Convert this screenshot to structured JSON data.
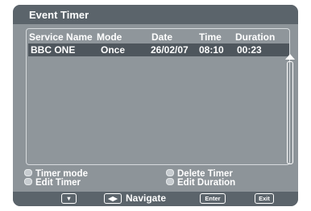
{
  "window": {
    "title": "Event Timer"
  },
  "table": {
    "headers": [
      "Service Name",
      "Mode",
      "Date",
      "Time",
      "Duration"
    ],
    "rows": [
      {
        "service": "BBC ONE",
        "mode": "Once",
        "date": "26/02/07",
        "time": "08:10",
        "duration": "00:23"
      }
    ]
  },
  "legend": {
    "timer_mode": "Timer mode",
    "edit_timer": "Edit Timer",
    "delete_timer": "Delete Timer",
    "edit_duration": "Edit Duration"
  },
  "footer": {
    "down_key": "▼",
    "navigate_key": "◀▶",
    "navigate_label": "Navigate",
    "enter_key": "Enter",
    "exit_key": "Exit"
  },
  "colors": {
    "background": "#8d9499",
    "bar": "#5b646b",
    "selected_row": "#4e565d",
    "text": "#ffffff"
  }
}
